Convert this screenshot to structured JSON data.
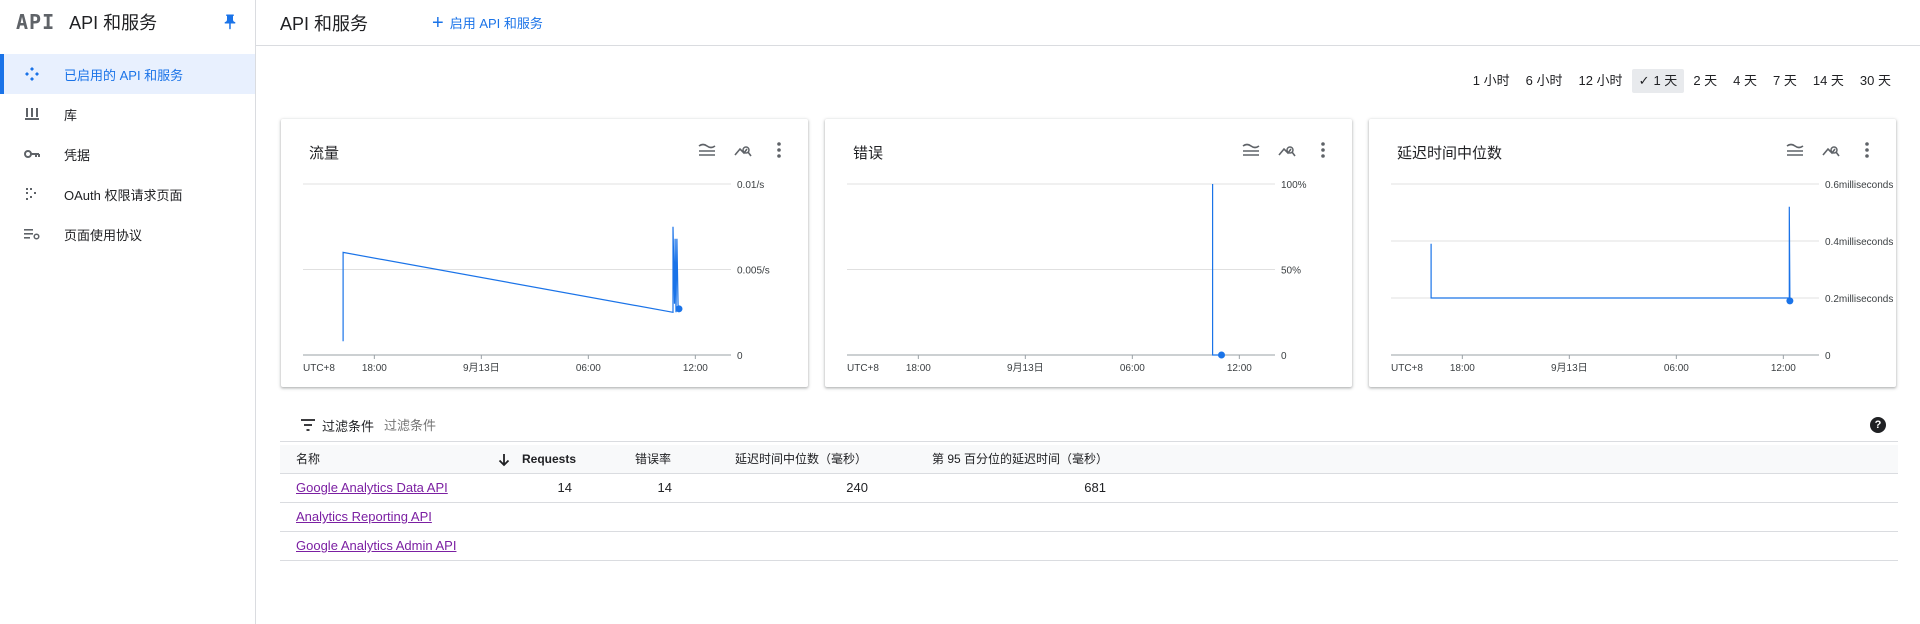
{
  "sidebar": {
    "logo": "API",
    "title": "API 和服务",
    "items": [
      {
        "label": "已启用的 API 和服务",
        "icon": "enabled-apis-icon",
        "active": true
      },
      {
        "label": "库",
        "icon": "library-icon",
        "active": false
      },
      {
        "label": "凭据",
        "icon": "key-icon",
        "active": false
      },
      {
        "label": "OAuth 权限请求页面",
        "icon": "oauth-consent-icon",
        "active": false
      },
      {
        "label": "页面使用协议",
        "icon": "page-usage-icon",
        "active": false
      }
    ]
  },
  "header": {
    "title": "API 和服务",
    "enable_button": "启用 API 和服务"
  },
  "time_range": {
    "options": [
      "1 小时",
      "6 小时",
      "12 小时",
      "1 天",
      "2 天",
      "4 天",
      "7 天",
      "14 天",
      "30 天"
    ],
    "selected": "1 天"
  },
  "charts": [
    {
      "title": "流量"
    },
    {
      "title": "错误"
    },
    {
      "title": "延迟时间中位数"
    }
  ],
  "chart_data": [
    {
      "type": "line",
      "title": "流量",
      "x_ticks": [
        "UTC+8",
        "18:00",
        "9月13日",
        "06:00",
        "12:00"
      ],
      "y_ticks": [
        "0.01/s",
        "0.005/s",
        "0"
      ],
      "ylim": [
        0,
        0.01
      ],
      "series": [
        {
          "values": [
            {
              "x": "2023-09-12T16:15",
              "y": 0.0008
            },
            {
              "x": "2023-09-12T16:15",
              "y": 0.006
            },
            {
              "x": "2023-09-13T10:45",
              "y": 0.0025
            },
            {
              "x": "2023-09-13T10:45",
              "y": 0.0075
            },
            {
              "x": "2023-09-13T10:50",
              "y": 0.003
            },
            {
              "x": "2023-09-13T10:52",
              "y": 0.0068
            },
            {
              "x": "2023-09-13T10:55",
              "y": 0.0025
            },
            {
              "x": "2023-09-13T10:58",
              "y": 0.0068
            },
            {
              "x": "2023-09-13T11:02",
              "y": 0.0028
            },
            {
              "x": "2023-09-13T11:05",
              "y": 0.0027
            }
          ]
        }
      ]
    },
    {
      "type": "line",
      "title": "错误",
      "x_ticks": [
        "UTC+8",
        "18:00",
        "9月13日",
        "06:00",
        "12:00"
      ],
      "y_ticks": [
        "100%",
        "50%",
        "0"
      ],
      "ylim": [
        0,
        100
      ],
      "series": [
        {
          "values": [
            {
              "x": "2023-09-13T10:30",
              "y": 0
            },
            {
              "x": "2023-09-13T10:30",
              "y": 100
            },
            {
              "x": "2023-09-13T10:30",
              "y": 0
            },
            {
              "x": "2023-09-13T11:00",
              "y": 0
            }
          ]
        }
      ]
    },
    {
      "type": "line",
      "title": "延迟时间中位数",
      "x_ticks": [
        "UTC+8",
        "18:00",
        "9月13日",
        "06:00",
        "12:00"
      ],
      "y_ticks": [
        "0.6milliseconds",
        "0.4milliseconds",
        "0.2milliseconds",
        "0"
      ],
      "ylim": [
        0,
        0.6
      ],
      "series": [
        {
          "values": [
            {
              "x": "2023-09-12T16:15",
              "y": 0.39
            },
            {
              "x": "2023-09-12T16:15",
              "y": 0.2
            },
            {
              "x": "2023-09-13T12:20",
              "y": 0.2
            },
            {
              "x": "2023-09-13T12:20",
              "y": 0.52
            },
            {
              "x": "2023-09-13T12:22",
              "y": 0.19
            }
          ]
        }
      ]
    }
  ],
  "filter": {
    "label": "过滤条件",
    "placeholder": "过滤条件"
  },
  "table": {
    "columns": [
      "名称",
      "Requests",
      "错误率",
      "延迟时间中位数（毫秒）",
      "第 95 百分位的延迟时间（毫秒）"
    ],
    "rows": [
      {
        "name": "Google Analytics Data API",
        "requests": "14",
        "errors": "14",
        "median": "240",
        "p95": "681"
      },
      {
        "name": "Analytics Reporting API",
        "requests": "",
        "errors": "",
        "median": "",
        "p95": ""
      },
      {
        "name": "Google Analytics Admin API",
        "requests": "",
        "errors": "",
        "median": "",
        "p95": ""
      }
    ]
  }
}
